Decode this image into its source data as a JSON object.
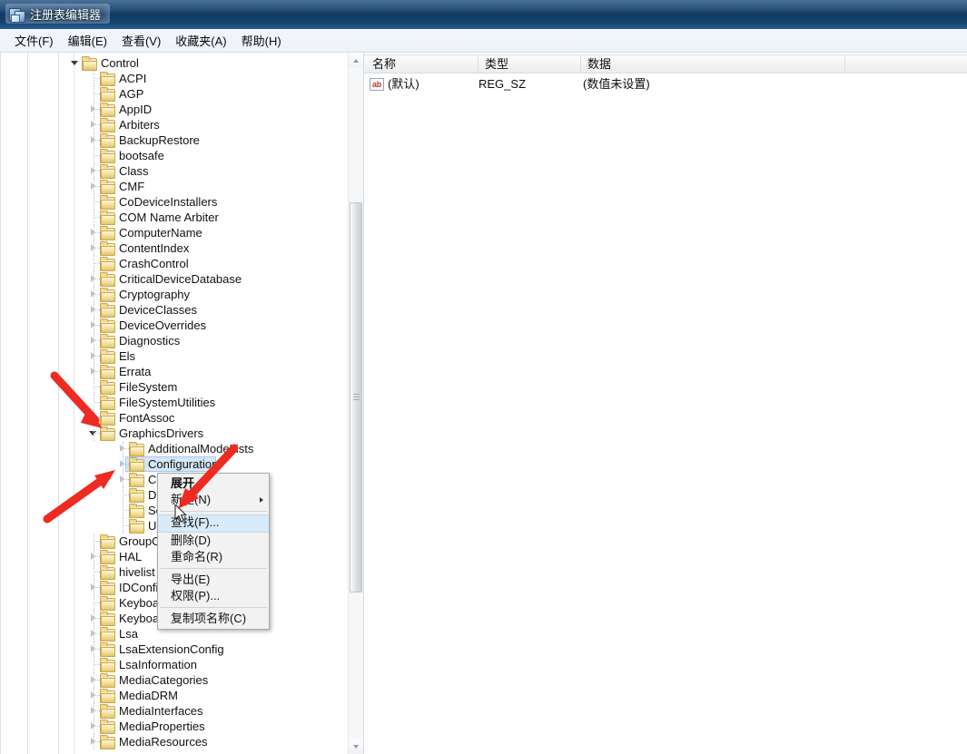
{
  "window": {
    "title": "注册表编辑器",
    "icon": "registry-editor-icon"
  },
  "menubar": {
    "items": [
      {
        "label": "文件(F)"
      },
      {
        "label": "编辑(E)"
      },
      {
        "label": "查看(V)"
      },
      {
        "label": "收藏夹(A)"
      },
      {
        "label": "帮助(H)"
      }
    ]
  },
  "tree": {
    "nodes": [
      {
        "label": "Control",
        "indent": 0,
        "state": "expanded"
      },
      {
        "label": "ACPI",
        "indent": 1,
        "state": "leaf"
      },
      {
        "label": "AGP",
        "indent": 1,
        "state": "leaf"
      },
      {
        "label": "AppID",
        "indent": 1,
        "state": "collapsed"
      },
      {
        "label": "Arbiters",
        "indent": 1,
        "state": "collapsed"
      },
      {
        "label": "BackupRestore",
        "indent": 1,
        "state": "collapsed"
      },
      {
        "label": "bootsafe",
        "indent": 1,
        "state": "leaf"
      },
      {
        "label": "Class",
        "indent": 1,
        "state": "collapsed"
      },
      {
        "label": "CMF",
        "indent": 1,
        "state": "collapsed"
      },
      {
        "label": "CoDeviceInstallers",
        "indent": 1,
        "state": "leaf"
      },
      {
        "label": "COM Name Arbiter",
        "indent": 1,
        "state": "leaf"
      },
      {
        "label": "ComputerName",
        "indent": 1,
        "state": "collapsed"
      },
      {
        "label": "ContentIndex",
        "indent": 1,
        "state": "collapsed"
      },
      {
        "label": "CrashControl",
        "indent": 1,
        "state": "leaf"
      },
      {
        "label": "CriticalDeviceDatabase",
        "indent": 1,
        "state": "collapsed"
      },
      {
        "label": "Cryptography",
        "indent": 1,
        "state": "collapsed"
      },
      {
        "label": "DeviceClasses",
        "indent": 1,
        "state": "collapsed"
      },
      {
        "label": "DeviceOverrides",
        "indent": 1,
        "state": "collapsed"
      },
      {
        "label": "Diagnostics",
        "indent": 1,
        "state": "collapsed"
      },
      {
        "label": "Els",
        "indent": 1,
        "state": "collapsed"
      },
      {
        "label": "Errata",
        "indent": 1,
        "state": "collapsed"
      },
      {
        "label": "FileSystem",
        "indent": 1,
        "state": "leaf"
      },
      {
        "label": "FileSystemUtilities",
        "indent": 1,
        "state": "leaf"
      },
      {
        "label": "FontAssoc",
        "indent": 1,
        "state": "collapsed"
      },
      {
        "label": "GraphicsDrivers",
        "indent": 1,
        "state": "expanded"
      },
      {
        "label": "AdditionalModeLists",
        "indent": 2,
        "state": "collapsed"
      },
      {
        "label": "Configuration",
        "indent": 2,
        "state": "collapsed",
        "selected": true
      },
      {
        "label": "Connectivity",
        "indent": 2,
        "state": "collapsed"
      },
      {
        "label": "DCI",
        "indent": 2,
        "state": "leaf"
      },
      {
        "label": "Scheduler",
        "indent": 2,
        "state": "leaf"
      },
      {
        "label": "UseNewKey",
        "indent": 2,
        "state": "leaf"
      },
      {
        "label": "GroupOrderList",
        "indent": 1,
        "state": "leaf"
      },
      {
        "label": "HAL",
        "indent": 1,
        "state": "collapsed"
      },
      {
        "label": "hivelist",
        "indent": 1,
        "state": "leaf"
      },
      {
        "label": "IDConfigDB",
        "indent": 1,
        "state": "collapsed"
      },
      {
        "label": "Keyboard Layout",
        "indent": 1,
        "state": "leaf"
      },
      {
        "label": "Keyboard Layouts",
        "indent": 1,
        "state": "collapsed"
      },
      {
        "label": "Lsa",
        "indent": 1,
        "state": "collapsed"
      },
      {
        "label": "LsaExtensionConfig",
        "indent": 1,
        "state": "collapsed"
      },
      {
        "label": "LsaInformation",
        "indent": 1,
        "state": "leaf"
      },
      {
        "label": "MediaCategories",
        "indent": 1,
        "state": "collapsed"
      },
      {
        "label": "MediaDRM",
        "indent": 1,
        "state": "collapsed"
      },
      {
        "label": "MediaInterfaces",
        "indent": 1,
        "state": "collapsed"
      },
      {
        "label": "MediaProperties",
        "indent": 1,
        "state": "collapsed"
      },
      {
        "label": "MediaResources",
        "indent": 1,
        "state": "collapsed"
      }
    ]
  },
  "values": {
    "columns": [
      {
        "label": "名称"
      },
      {
        "label": "类型"
      },
      {
        "label": "数据"
      }
    ],
    "rows": [
      {
        "icon": "string-value-icon",
        "name": "(默认)",
        "type": "REG_SZ",
        "data": "(数值未设置)"
      }
    ]
  },
  "context_menu": {
    "items": [
      {
        "label": "展开",
        "bold": true,
        "type": "item"
      },
      {
        "label": "新建(N)",
        "submenu": true,
        "type": "item"
      },
      {
        "type": "separator"
      },
      {
        "label": "查找(F)...",
        "highlight": true,
        "type": "item"
      },
      {
        "label": "删除(D)",
        "type": "item"
      },
      {
        "label": "重命名(R)",
        "type": "item"
      },
      {
        "type": "separator"
      },
      {
        "label": "导出(E)",
        "type": "item"
      },
      {
        "label": "权限(P)...",
        "type": "item"
      },
      {
        "type": "separator"
      },
      {
        "label": "复制项名称(C)",
        "type": "item"
      }
    ]
  },
  "annotations": {
    "arrow_color": "#ee2b22",
    "arrows": [
      {
        "name": "arrow-to-graphicsdrivers"
      },
      {
        "name": "arrow-to-configuration"
      },
      {
        "name": "arrow-to-find-menu-item"
      }
    ]
  },
  "colors": {
    "titlebar": "#17436d",
    "selection": "#d3e7f9",
    "menu_highlight": "#d9eaf8",
    "folder": "#efd88f"
  }
}
